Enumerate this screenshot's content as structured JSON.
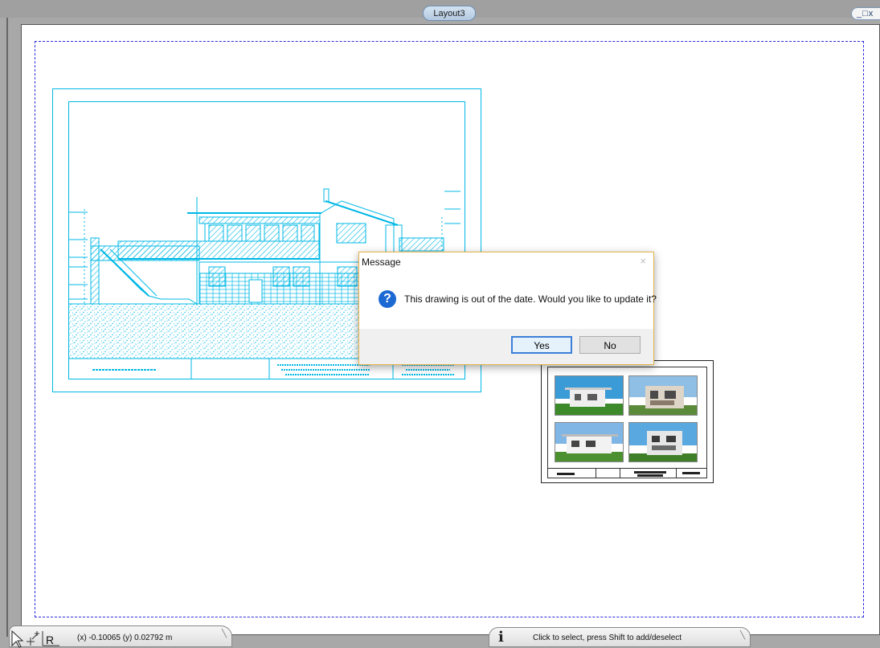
{
  "layout_tab": {
    "label": "Layout3"
  },
  "window_controls": {
    "minimize": "_",
    "restore": "□",
    "close": "x"
  },
  "dialog": {
    "title": "Message",
    "close_glyph": "×",
    "icon_glyph": "?",
    "message": "This drawing is out of the date. Would you like to update it?",
    "yes_label": "Yes",
    "no_label": "No"
  },
  "coordinates": {
    "text": "(x) -0.10065  (y) 0.02792 m"
  },
  "status": {
    "text": "Click to select, press Shift to add/deselect",
    "icon_glyph": "i"
  },
  "colors": {
    "cad_line": "#00b8e6",
    "print_frame": "#2a2ad8",
    "dialog_border": "#e4b34a",
    "question_icon": "#1c69d3",
    "primary_button_border": "#3c7fd8"
  },
  "icons": [
    "question-icon",
    "info-icon",
    "select-arrow-icon",
    "snap-icon",
    "reference-icon",
    "close-icon"
  ]
}
